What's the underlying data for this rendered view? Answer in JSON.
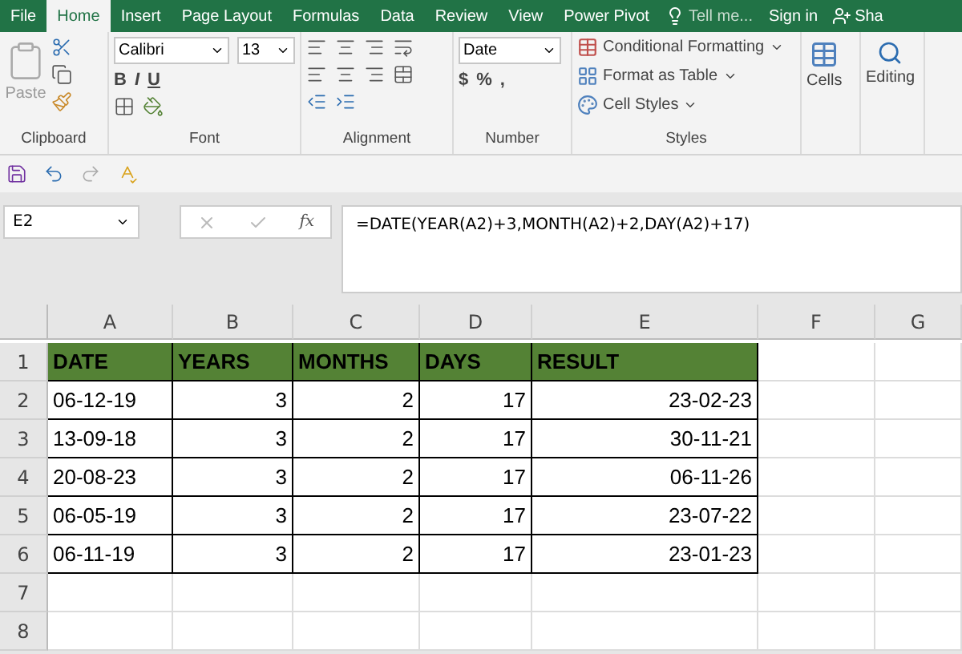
{
  "tabs": [
    {
      "label": "File",
      "selected": false
    },
    {
      "label": "Home",
      "selected": true
    },
    {
      "label": "Insert",
      "selected": false
    },
    {
      "label": "Page Layout",
      "selected": false
    },
    {
      "label": "Formulas",
      "selected": false
    },
    {
      "label": "Data",
      "selected": false
    },
    {
      "label": "Review",
      "selected": false
    },
    {
      "label": "View",
      "selected": false
    },
    {
      "label": "Power Pivot",
      "selected": false
    }
  ],
  "tell_me": "Tell me...",
  "sign_in": "Sign in",
  "user": "Sha",
  "ribbon": {
    "clipboard": {
      "label": "Clipboard",
      "paste": "Paste"
    },
    "font": {
      "label": "Font",
      "name": "Calibri",
      "size": "13",
      "bold": "B",
      "italic": "I",
      "underline": "U"
    },
    "alignment": {
      "label": "Alignment"
    },
    "number": {
      "label": "Number",
      "format": "Date",
      "currency": "$",
      "percent": "%",
      "comma": ","
    },
    "styles": {
      "label": "Styles",
      "items": [
        "Conditional Formatting",
        "Format as Table",
        "Cell Styles"
      ]
    },
    "cells": {
      "label": "Cells"
    },
    "editing": {
      "label": "Editing"
    }
  },
  "name_box": "E2",
  "fx": "fx",
  "formula": "=DATE(YEAR(A2)+3,MONTH(A2)+2,DAY(A2)+17)",
  "columns": [
    "A",
    "B",
    "C",
    "D",
    "E",
    "F",
    "G"
  ],
  "header_row": {
    "number": "1",
    "cells": [
      "DATE",
      "YEARS",
      "MONTHS",
      "DAYS",
      "RESULT"
    ]
  },
  "rows": [
    {
      "number": "2",
      "cells": [
        "06-12-19",
        "3",
        "2",
        "17",
        "23-02-23"
      ]
    },
    {
      "number": "3",
      "cells": [
        "13-09-18",
        "3",
        "2",
        "17",
        "30-11-21"
      ]
    },
    {
      "number": "4",
      "cells": [
        "20-08-23",
        "3",
        "2",
        "17",
        "06-11-26"
      ]
    },
    {
      "number": "5",
      "cells": [
        "06-05-19",
        "3",
        "2",
        "17",
        "23-07-22"
      ]
    },
    {
      "number": "6",
      "cells": [
        "06-11-19",
        "3",
        "2",
        "17",
        "23-01-23"
      ]
    },
    {
      "number": "7"
    },
    {
      "number": "8"
    }
  ]
}
